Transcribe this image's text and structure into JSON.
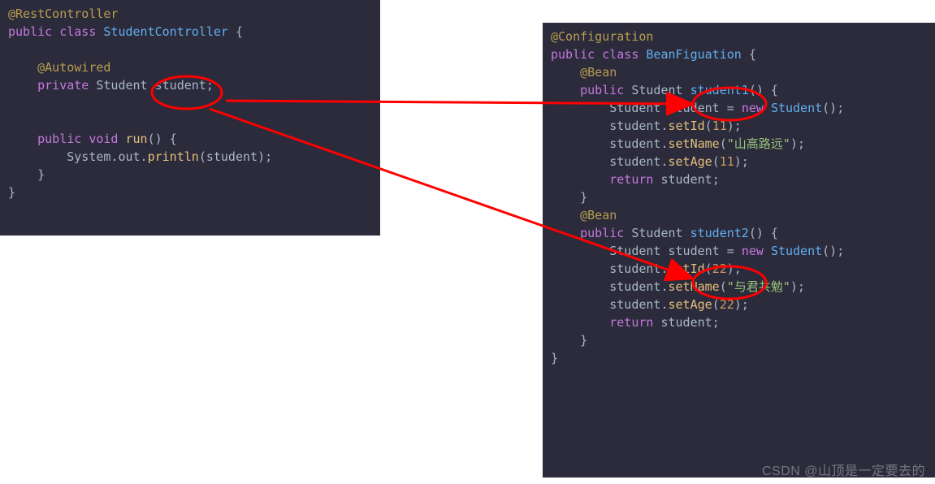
{
  "left": {
    "ann_rest": "@RestController",
    "cls_decl_a": "public",
    "cls_decl_b": "class",
    "cls_name": "StudentController",
    "brace_open": " {",
    "ann_autowired": "@Autowired",
    "field_a": "private",
    "field_type": "Student",
    "field_name": "student",
    "semi": ";",
    "run_a": "public",
    "run_b": "void",
    "run_name": "run",
    "run_paren": "() {",
    "sysout_a": "System",
    "sysout_b": ".out.",
    "sysout_c": "println",
    "sysout_arg": "student",
    "sysout_close": ");",
    "brace_close": "}",
    "brace_end": "}"
  },
  "right": {
    "ann_config": "@Configuration",
    "cls_a": "public",
    "cls_b": "class",
    "cls_name": "BeanFiguation",
    "brace_open": " {",
    "ann_bean": "@Bean",
    "s1_a": "public",
    "s1_type": "Student",
    "s1_name": "student1",
    "s1_paren": "() {",
    "newline_a": "Student",
    "newline_b": "student",
    "newline_c": "=",
    "newline_d": "new",
    "newline_e": "Student",
    "newline_f": "();",
    "setid": "setId",
    "s1_id": "11",
    "setname": "setName",
    "s1_str": "\"山高路远\"",
    "setage": "setAge",
    "s1_age": "11",
    "ret": "return",
    "retvar": "student",
    "s2_name": "student2",
    "s2_id": "22",
    "s2_str": "\"与君共勉\"",
    "s2_age": "22"
  },
  "watermark": "CSDN @山顶是一定要去的"
}
